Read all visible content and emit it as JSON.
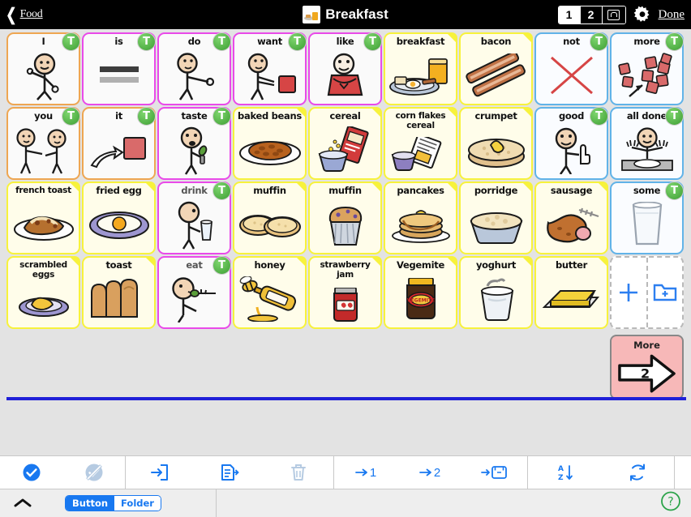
{
  "topbar": {
    "back_label": "Food",
    "title": "Breakfast",
    "title_icon": "breakfast-plate-icon",
    "page_1": "1",
    "page_2": "2",
    "lock_icon": "lock-icon",
    "gear_icon": "gear-icon",
    "done_label": "Done"
  },
  "grid": {
    "rows": [
      [
        {
          "label": "I",
          "type": "pronoun",
          "art": "person-pointing-self",
          "badge": "T"
        },
        {
          "label": "is",
          "type": "verb",
          "art": "equals-bars",
          "badge": "T"
        },
        {
          "label": "do",
          "type": "verb",
          "art": "person-reaching",
          "badge": "T"
        },
        {
          "label": "want",
          "type": "verb",
          "art": "person-wanting-block",
          "badge": "T"
        },
        {
          "label": "like",
          "type": "verb",
          "art": "person-heart-hug",
          "badge": "T"
        },
        {
          "label": "breakfast",
          "type": "noun",
          "art": "breakfast-plate",
          "badge": ""
        },
        {
          "label": "bacon",
          "type": "noun",
          "art": "bacon-strips",
          "badge": ""
        },
        {
          "label": "not",
          "type": "mod",
          "art": "red-cross",
          "badge": "T"
        },
        {
          "label": "more",
          "type": "mod",
          "art": "more-blocks-arrow",
          "badge": "T"
        }
      ],
      [
        {
          "label": "you",
          "type": "pronoun",
          "art": "two-people-pointing",
          "badge": "T"
        },
        {
          "label": "it",
          "type": "pronoun",
          "art": "hand-pointing-block",
          "badge": "T"
        },
        {
          "label": "taste",
          "type": "verb",
          "art": "person-tasting",
          "badge": "T"
        },
        {
          "label": "baked beans",
          "type": "noun",
          "art": "plate-of-beans",
          "badge": ""
        },
        {
          "label": "cereal",
          "type": "noun",
          "art": "cereal-box-bowl",
          "badge": ""
        },
        {
          "label": "corn flakes cereal",
          "type": "noun",
          "art": "cornflakes-box-bowl",
          "badge": ""
        },
        {
          "label": "crumpet",
          "type": "noun",
          "art": "crumpet-butter",
          "badge": ""
        },
        {
          "label": "good",
          "type": "mod",
          "art": "person-thumbs-up",
          "badge": "T"
        },
        {
          "label": "all done",
          "type": "mod",
          "art": "person-empty-plate",
          "badge": "T"
        }
      ],
      [
        {
          "label": "french toast",
          "type": "noun",
          "art": "french-toast-plate",
          "badge": ""
        },
        {
          "label": "fried egg",
          "type": "noun",
          "art": "fried-egg-plate",
          "badge": ""
        },
        {
          "label": "drink",
          "type": "verb",
          "art": "person-drinking",
          "badge": "T"
        },
        {
          "label": "muffin",
          "type": "noun",
          "art": "english-muffin-halves",
          "badge": ""
        },
        {
          "label": "muffin",
          "type": "noun",
          "art": "blueberry-muffin",
          "badge": ""
        },
        {
          "label": "pancakes",
          "type": "noun",
          "art": "pancake-stack",
          "badge": ""
        },
        {
          "label": "porridge",
          "type": "noun",
          "art": "porridge-bowl",
          "badge": ""
        },
        {
          "label": "sausage",
          "type": "noun",
          "art": "sausage-fork",
          "badge": ""
        },
        {
          "label": "some",
          "type": "mod",
          "art": "glass-of-milk",
          "badge": "T"
        }
      ],
      [
        {
          "label": "scrambled eggs",
          "type": "noun",
          "art": "scrambled-eggs-plate",
          "badge": ""
        },
        {
          "label": "toast",
          "type": "noun",
          "art": "toast-slices",
          "badge": ""
        },
        {
          "label": "eat",
          "type": "verb",
          "art": "person-eating-fork",
          "badge": "T"
        },
        {
          "label": "honey",
          "type": "noun",
          "art": "honey-squeeze-bee",
          "badge": ""
        },
        {
          "label": "strawberry jam",
          "type": "noun",
          "art": "jam-jar",
          "badge": ""
        },
        {
          "label": "Vegemite",
          "type": "noun",
          "art": "vegemite-jar",
          "badge": ""
        },
        {
          "label": "yoghurt",
          "type": "noun",
          "art": "yoghurt-tub-spoon",
          "badge": ""
        },
        {
          "label": "butter",
          "type": "noun",
          "art": "butter-block",
          "badge": ""
        }
      ]
    ],
    "add_button": {
      "plus_icon": "plus-icon",
      "folder_icon": "add-folder-icon"
    }
  },
  "more_button": {
    "label": "More",
    "page_number": "2"
  },
  "toolbar": {
    "groups": [
      [
        {
          "name": "select-all-button",
          "icon": "check-circle-icon",
          "label": ""
        },
        {
          "name": "deselect-all-button",
          "icon": "deselect-icon",
          "label": ""
        }
      ],
      [
        {
          "name": "move-button",
          "icon": "move-into-icon",
          "label": ""
        },
        {
          "name": "copy-button",
          "icon": "copy-icon",
          "label": ""
        },
        {
          "name": "delete-button",
          "icon": "trash-icon",
          "label": ""
        }
      ],
      [
        {
          "name": "send-to-page-1-button",
          "icon": "arrow-to-icon",
          "label": "1"
        },
        {
          "name": "send-to-page-2-button",
          "icon": "arrow-to-icon",
          "label": "2"
        },
        {
          "name": "send-to-store-button",
          "icon": "arrow-to-box-icon",
          "label": ""
        }
      ],
      [
        {
          "name": "sort-alphabetical-button",
          "icon": "sort-az-icon",
          "label": ""
        },
        {
          "name": "refresh-button",
          "icon": "refresh-icon",
          "label": ""
        }
      ],
      [
        {
          "name": "swap-button",
          "icon": "swap-icon",
          "label": ""
        }
      ]
    ]
  },
  "bottombar": {
    "collapse_icon": "chevron-up-icon",
    "toggle_button": "Button",
    "toggle_folder": "Folder",
    "help_icon": "help-icon"
  },
  "colors": {
    "pronoun_border": "#eea652",
    "verb_border": "#e94ae9",
    "noun_border": "#f7f23c",
    "mod_border": "#61b3e8",
    "accent_blue": "#1878f0",
    "divider_blue": "#2020d8",
    "more_pink": "#f7b8b8",
    "badge_green": "#3d9e33"
  }
}
